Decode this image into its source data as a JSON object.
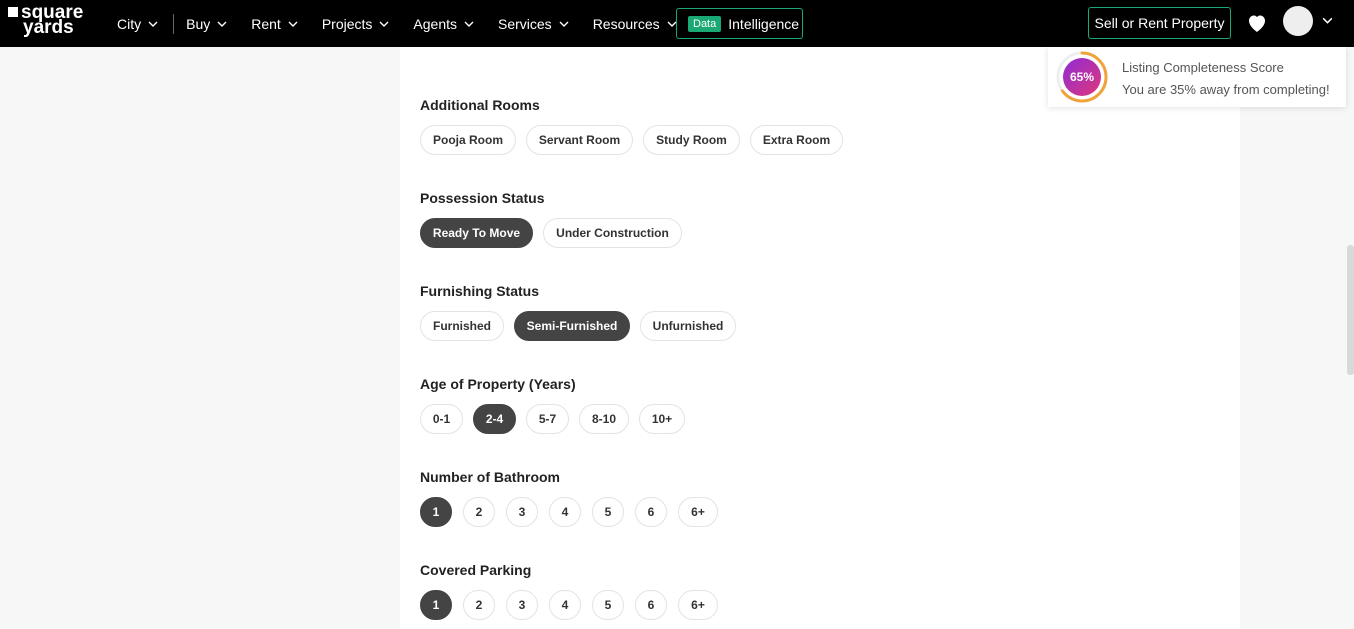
{
  "header": {
    "logo_line1": "square",
    "logo_line2": "yards",
    "nav": [
      "City",
      "Buy",
      "Rent",
      "Projects",
      "Agents",
      "Services",
      "Resources"
    ],
    "data_badge": "Data",
    "intelligence_label": "Intelligence",
    "sell_button": "Sell or Rent Property"
  },
  "score": {
    "percent_label": "65%",
    "value": 0.65,
    "title": "Listing Completeness Score",
    "subtitle": "You are 35% away from completing!"
  },
  "sections": {
    "additional_rooms": {
      "title": "Additional Rooms",
      "options": [
        "Pooja Room",
        "Servant Room",
        "Study Room",
        "Extra Room"
      ]
    },
    "possession": {
      "title": "Possession Status",
      "options": [
        "Ready To Move",
        "Under Construction"
      ],
      "selected": "Ready To Move"
    },
    "furnishing": {
      "title": "Furnishing Status",
      "options": [
        "Furnished",
        "Semi-Furnished",
        "Unfurnished"
      ],
      "selected": "Semi-Furnished"
    },
    "age": {
      "title": "Age of Property (Years)",
      "options": [
        "0-1",
        "2-4",
        "5-7",
        "8-10",
        "10+"
      ],
      "selected": "2-4"
    },
    "bathroom": {
      "title": "Number of Bathroom",
      "options": [
        "1",
        "2",
        "3",
        "4",
        "5",
        "6",
        "6+"
      ],
      "selected": "1"
    },
    "parking": {
      "title": "Covered Parking",
      "options": [
        "1",
        "2",
        "3",
        "4",
        "5",
        "6",
        "6+"
      ],
      "selected": "1"
    }
  },
  "colors": {
    "accent_green": "#1aa874",
    "selected_chip": "#444444",
    "ring_purple": "#8e2bd6",
    "ring_pink": "#e0377a"
  }
}
